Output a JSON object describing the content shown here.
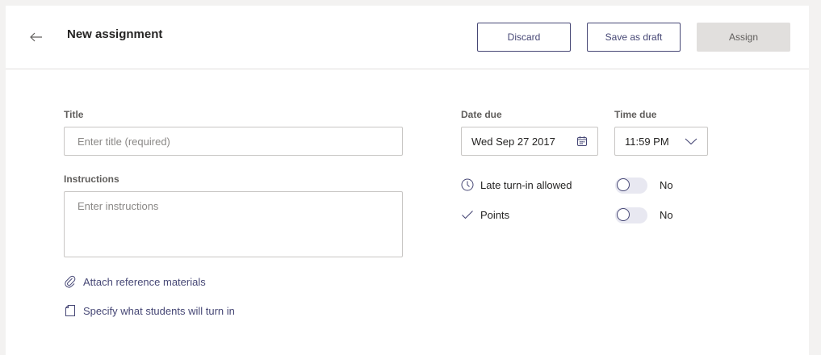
{
  "header": {
    "title": "New assignment",
    "back_icon": "arrow-left-icon",
    "discard_label": "Discard",
    "save_draft_label": "Save as draft",
    "assign_label": "Assign"
  },
  "form": {
    "title_label": "Title",
    "title_placeholder": "Enter title (required)",
    "title_value": "",
    "instructions_label": "Instructions",
    "instructions_placeholder": "Enter instructions",
    "instructions_value": "",
    "attach_label": "Attach reference materials",
    "attach_icon": "paperclip-icon",
    "specify_label": "Specify what students will turn in",
    "specify_icon": "document-icon"
  },
  "schedule": {
    "date_due_label": "Date due",
    "date_due_value": "Wed Sep 27 2017",
    "date_icon": "calendar-icon",
    "time_due_label": "Time due",
    "time_due_value": "11:59 PM",
    "time_icon": "chevron-down-icon"
  },
  "options": {
    "late_label": "Late turn-in allowed",
    "late_icon": "clock-icon",
    "late_value": "No",
    "points_label": "Points",
    "points_icon": "checkmark-icon",
    "points_value": "No"
  },
  "colors": {
    "accent": "#464775",
    "border": "#c8c6c4",
    "background": "#f3f2f1",
    "disabled": "#e1dfdd"
  }
}
